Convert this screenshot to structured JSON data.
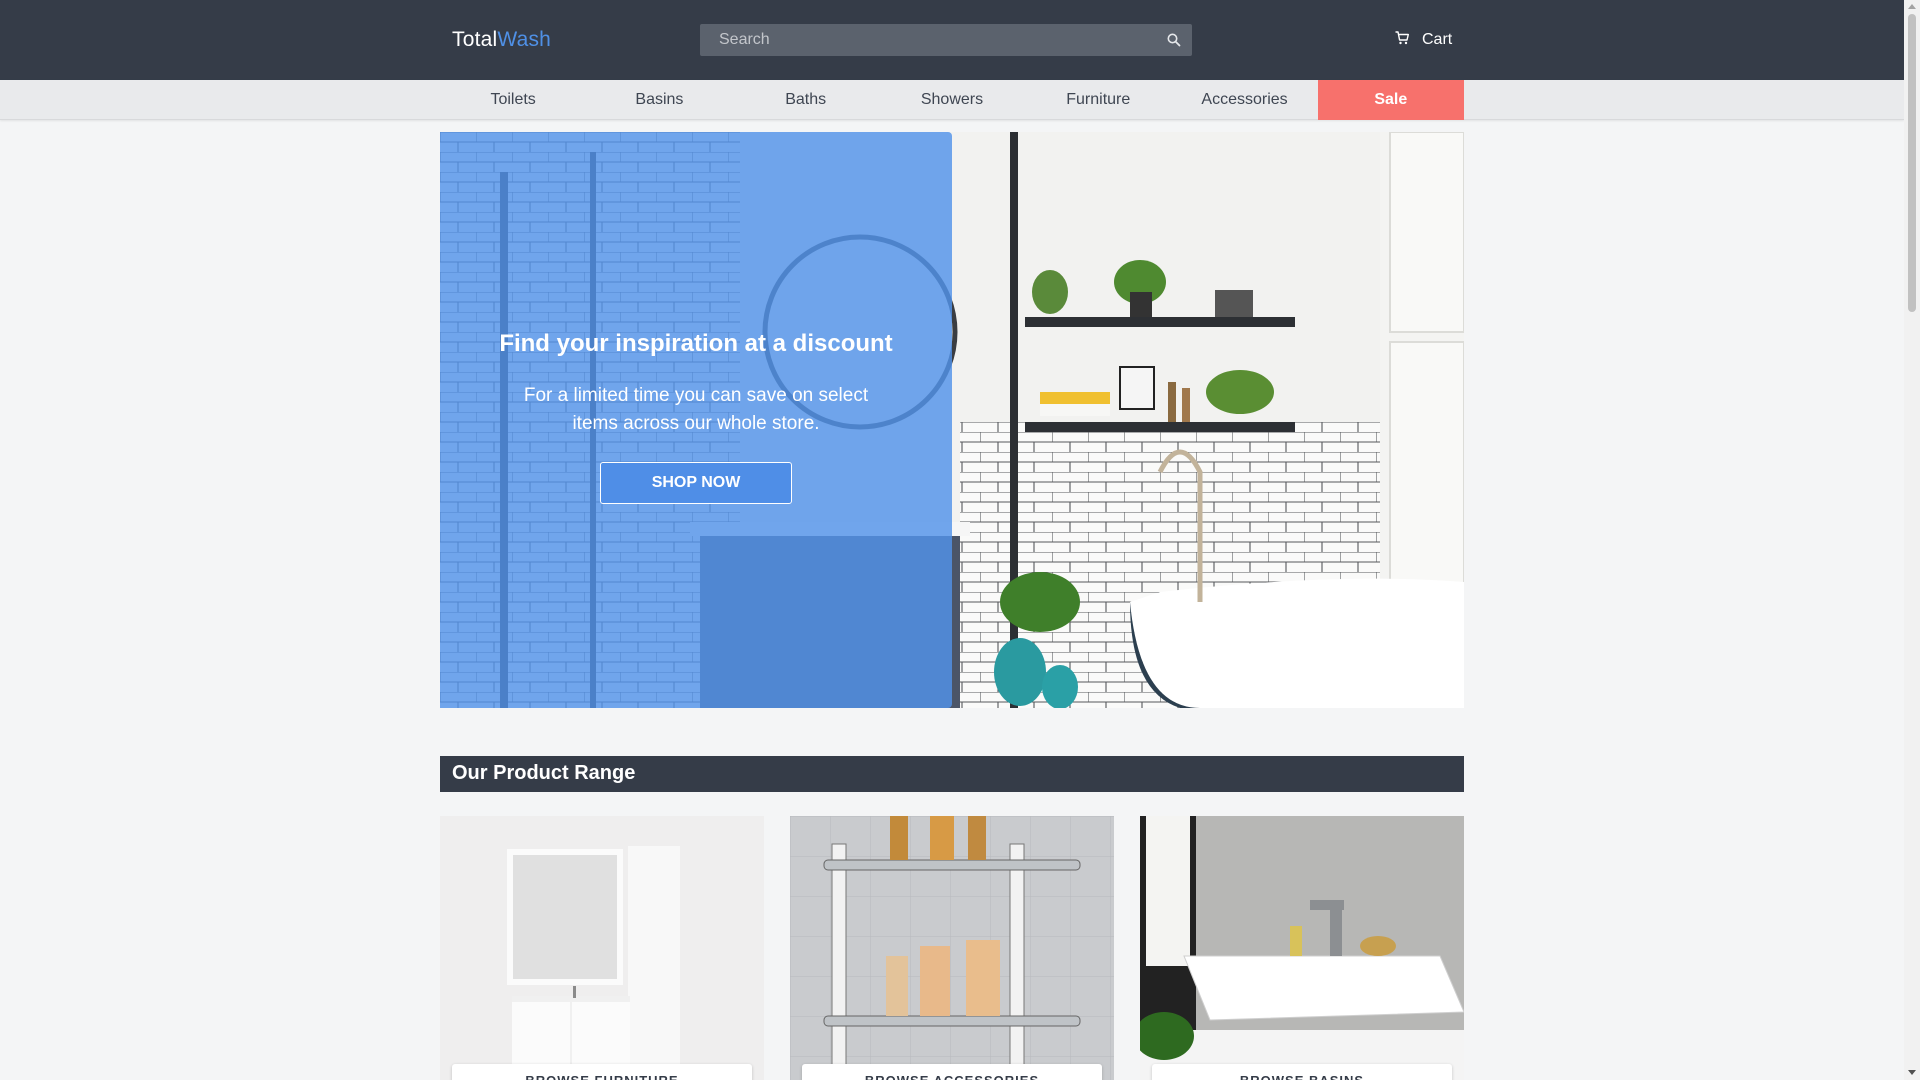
{
  "header": {
    "logo": {
      "part1": "Total",
      "part2": "Wash",
      "accent_color": "#4f90e6"
    },
    "search": {
      "placeholder": "Search",
      "value": "",
      "icon": "search-icon"
    },
    "cart": {
      "label": "Cart",
      "icon": "cart-icon"
    },
    "background": "#353c48"
  },
  "nav": {
    "items": [
      {
        "label": "Toilets"
      },
      {
        "label": "Basins"
      },
      {
        "label": "Baths"
      },
      {
        "label": "Showers"
      },
      {
        "label": "Furniture"
      },
      {
        "label": "Accessories"
      },
      {
        "label": "Sale",
        "highlight_color": "#f7716c"
      }
    ]
  },
  "hero": {
    "title": "Find your inspiration at a discount",
    "subtitle": "For a limited time you can save on select items across our whole store.",
    "button": "SHOP NOW",
    "overlay_color": "#5292e9"
  },
  "products": {
    "heading": "Our Product Range",
    "cards": [
      {
        "label": "BROWSE FURNITURE"
      },
      {
        "label": "BROWSE ACCESSORIES"
      },
      {
        "label": "BROWSE BASINS"
      }
    ]
  }
}
